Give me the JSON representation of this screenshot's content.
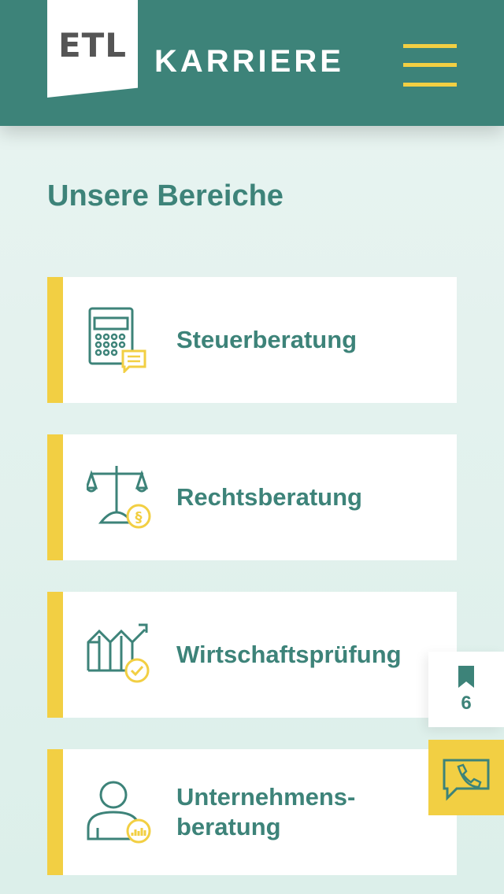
{
  "header": {
    "logo_text": "ETL",
    "brand": "KARRIERE",
    "menu_icon": "hamburger-menu-icon",
    "colors": {
      "primary": "#3d8379",
      "accent": "#f2cf43"
    }
  },
  "page": {
    "title": "Unsere Bereiche"
  },
  "cards": [
    {
      "label": "Steuerberatung",
      "icon": "calculator-icon"
    },
    {
      "label": "Rechtsberatung",
      "icon": "scales-icon"
    },
    {
      "label": "Wirtschaftsprüfung",
      "icon": "chart-check-icon"
    },
    {
      "label": "Unternehmens-\nberatung",
      "icon": "person-chart-icon"
    }
  ],
  "floating": {
    "bookmark_count": "6",
    "bookmark_icon": "bookmark-icon",
    "phone_icon": "phone-chat-icon"
  }
}
